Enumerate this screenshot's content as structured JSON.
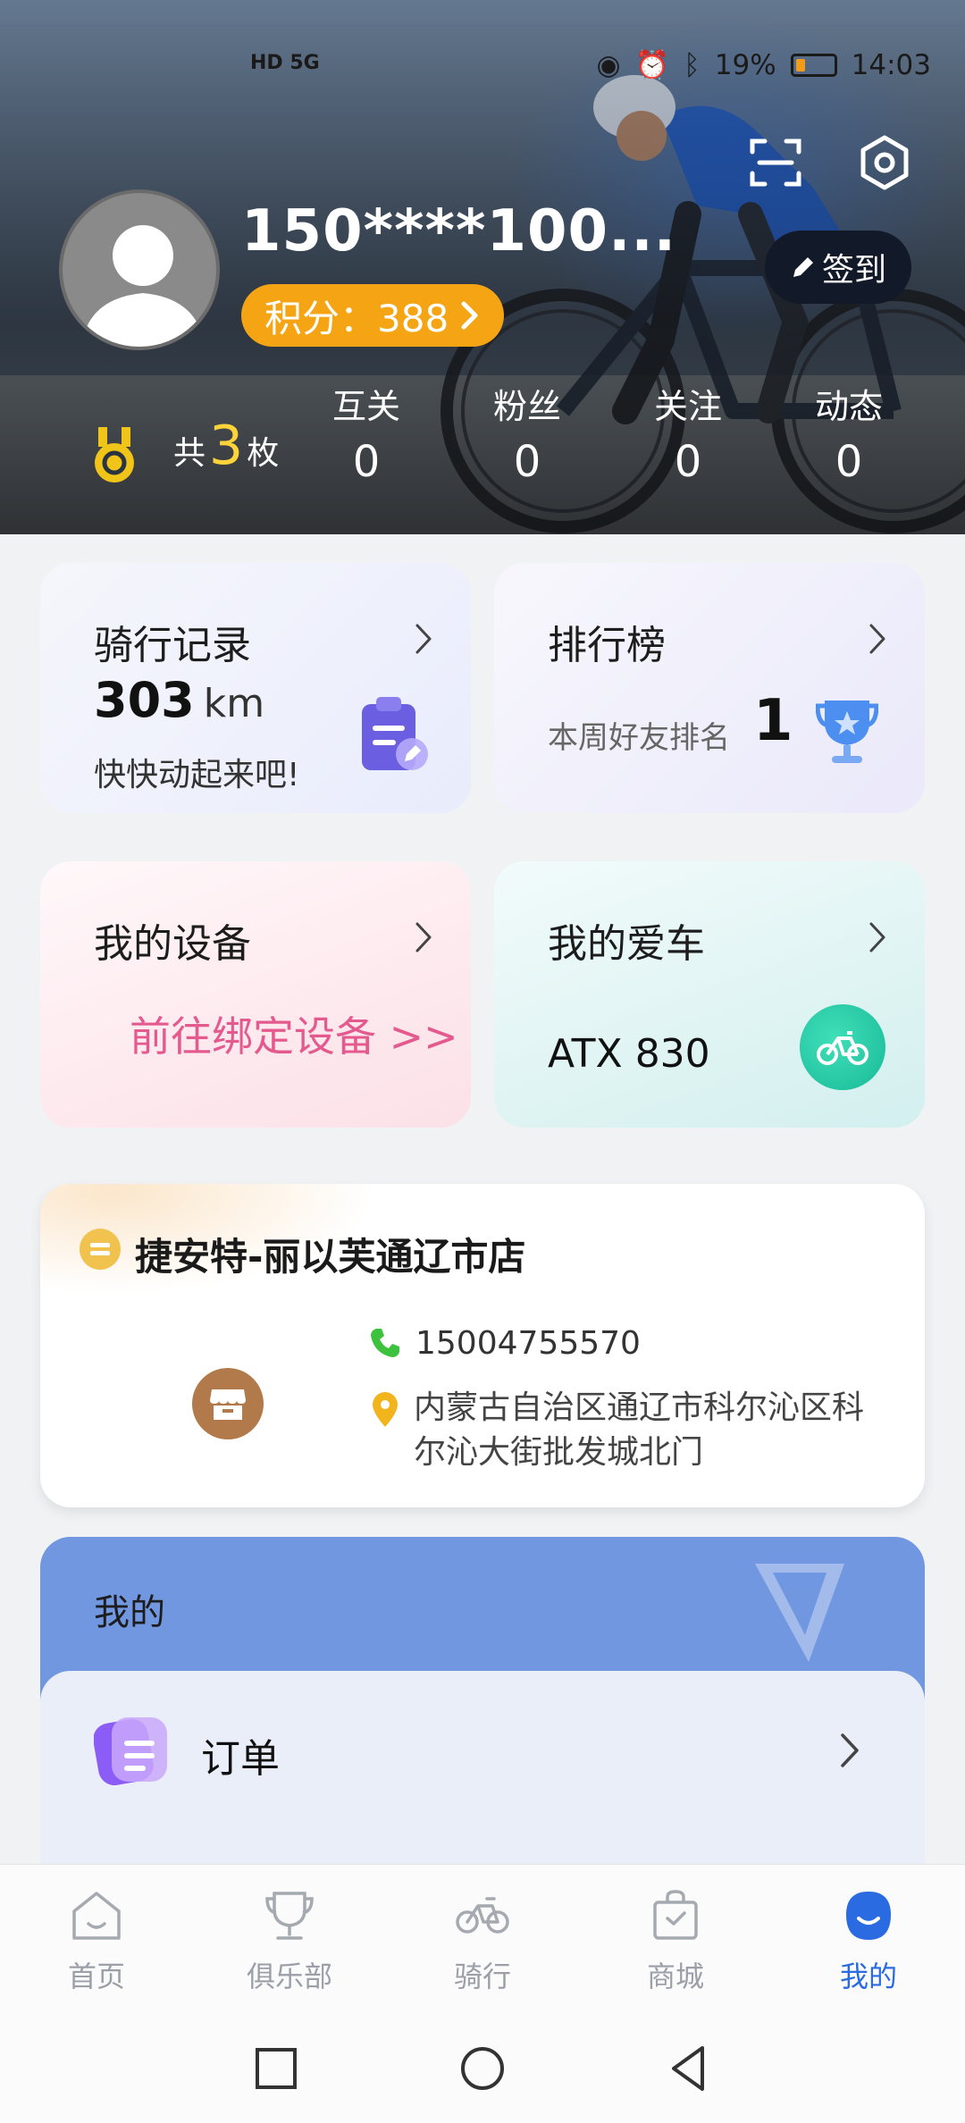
{
  "status_bar": {
    "network": "HD 5G",
    "battery": "19%",
    "time": "14:03"
  },
  "header": {
    "username": "150****100...",
    "points_label": "积分：388",
    "checkin_label": "签到",
    "medal": {
      "prefix": "共",
      "count": "3",
      "suffix": "枚"
    },
    "stats": [
      {
        "label": "互关",
        "value": "0"
      },
      {
        "label": "粉丝",
        "value": "0"
      },
      {
        "label": "关注",
        "value": "0"
      },
      {
        "label": "动态",
        "value": "0"
      }
    ]
  },
  "ride_record": {
    "title": "骑行记录",
    "distance": "303",
    "unit": "km",
    "subtitle": "快快动起来吧!"
  },
  "ranking": {
    "title": "排行榜",
    "subtitle": "本周好友排名",
    "rank": "1"
  },
  "devices": {
    "title": "我的设备",
    "link": "前往绑定设备 >>"
  },
  "bike": {
    "title": "我的爱车",
    "name": "ATX 830"
  },
  "shop": {
    "name": "捷安特-丽以芙通辽市店",
    "phone": "15004755570",
    "address": "内蒙古自治区通辽市科尔沁区科尔沁大街批发城北门"
  },
  "mine": {
    "title": "我的",
    "items": [
      {
        "label": "订单"
      }
    ]
  },
  "tabs": [
    {
      "label": "首页",
      "icon": "home-icon"
    },
    {
      "label": "俱乐部",
      "icon": "trophy-icon"
    },
    {
      "label": "骑行",
      "icon": "bicycle-icon"
    },
    {
      "label": "商城",
      "icon": "shopping-bag-icon"
    },
    {
      "label": "我的",
      "icon": "profile-icon"
    }
  ],
  "colors": {
    "accent": "#2a6be2",
    "points": "#f5a414",
    "device_link": "#e45a8e",
    "mine_header": "#7197e1"
  }
}
